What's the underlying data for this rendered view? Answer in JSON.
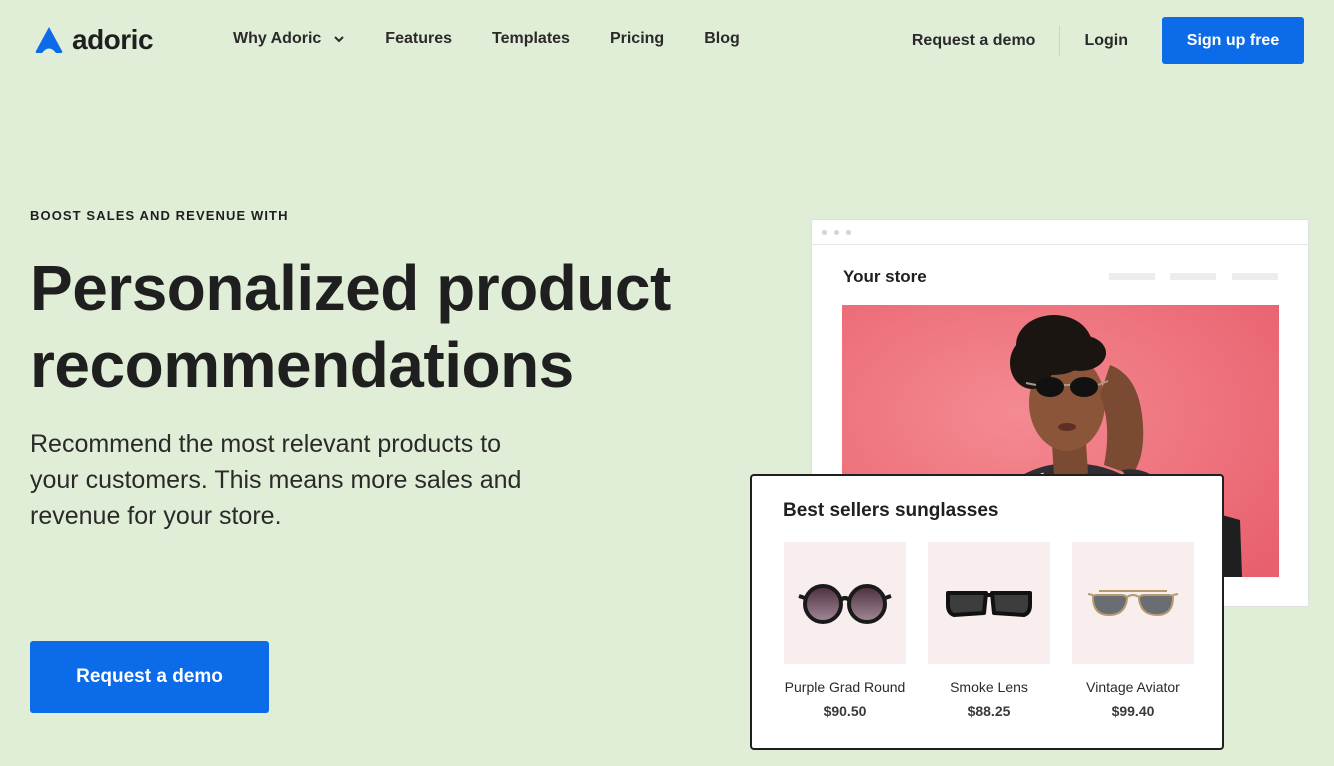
{
  "brand": {
    "name": "adoric",
    "accent": "#0b6be8",
    "background": "#e1eed7"
  },
  "nav": {
    "items": [
      "Why Adoric",
      "Features",
      "Templates",
      "Pricing",
      "Blog"
    ],
    "dropdown_icon": "chevron-down-icon"
  },
  "header_actions": {
    "request_demo": "Request a demo",
    "login": "Login",
    "signup": "Sign up free"
  },
  "hero": {
    "eyebrow": "BOOST SALES AND REVENUE WITH",
    "headline": "Personalized product recommendations",
    "subtext": "Recommend the most relevant products to your customers. This means more sales and revenue for your store.",
    "cta": "Request a demo"
  },
  "store_mockup": {
    "title": "Your store",
    "photo_background": "#ee6f7a"
  },
  "bestsellers": {
    "title": "Best sellers sunglasses",
    "products": [
      {
        "name": "Purple Grad Round",
        "price": "$90.50",
        "icon": "round-sunglasses-icon"
      },
      {
        "name": "Smoke Lens",
        "price": "$88.25",
        "icon": "smoke-lens-sunglasses-icon"
      },
      {
        "name": "Vintage Aviator",
        "price": "$99.40",
        "icon": "aviator-sunglasses-icon"
      }
    ]
  }
}
